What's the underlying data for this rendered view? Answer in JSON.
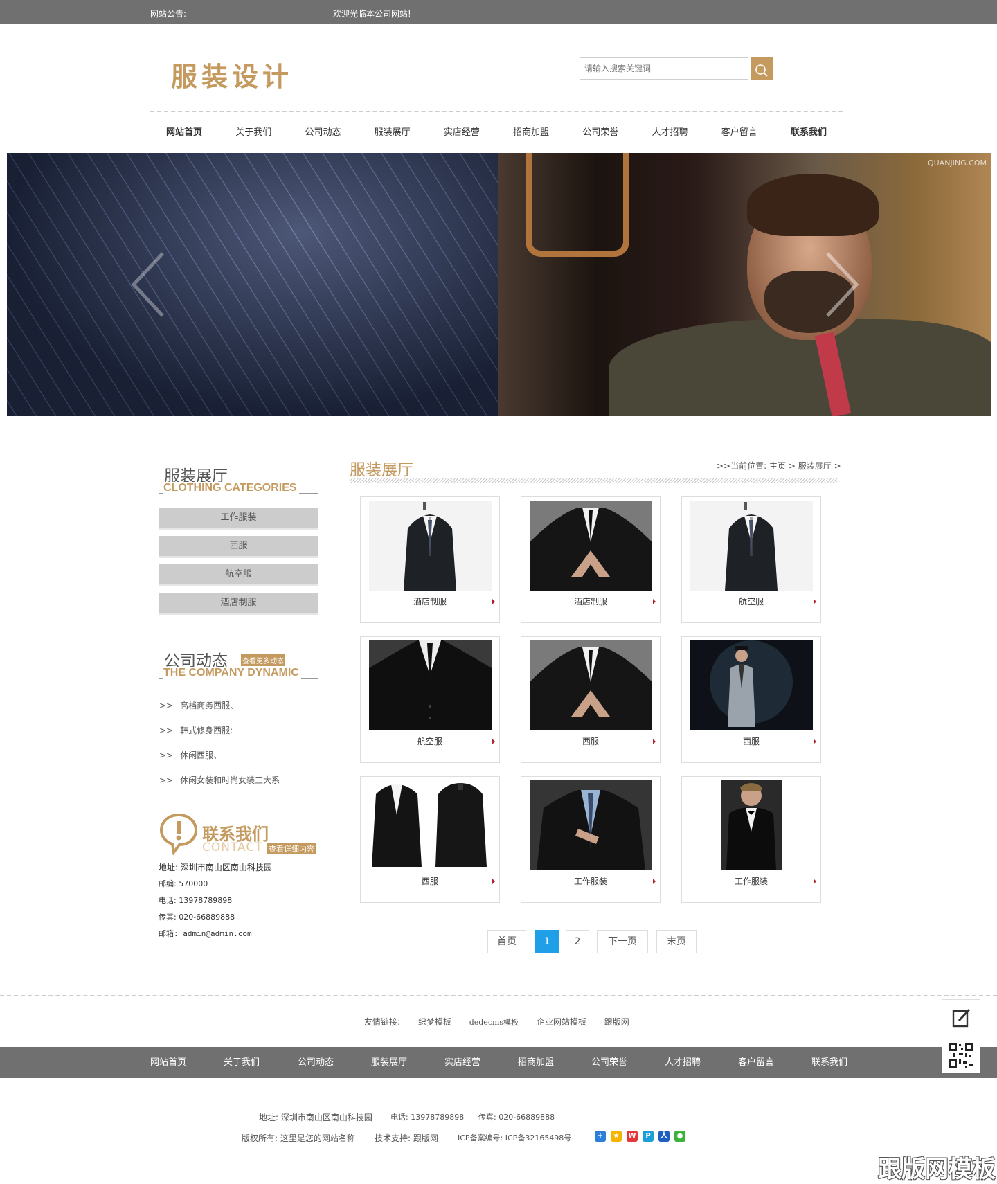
{
  "topbar": {
    "notice_label": "网站公告:",
    "notice_text": "欢迎光临本公司网站!"
  },
  "header": {
    "logo_text": "服装设计",
    "search_placeholder": "请输入搜索关键词"
  },
  "nav": [
    {
      "label": "网站首页",
      "active": true
    },
    {
      "label": "关于我们"
    },
    {
      "label": "公司动态"
    },
    {
      "label": "服装展厅"
    },
    {
      "label": "实店经营"
    },
    {
      "label": "招商加盟"
    },
    {
      "label": "公司荣誉"
    },
    {
      "label": "人才招聘"
    },
    {
      "label": "客户留言"
    },
    {
      "label": "联系我们",
      "bold": true
    }
  ],
  "banner": {
    "watermark": "QUANJING.COM"
  },
  "sidebar": {
    "categories_title_cn": "服装展厅",
    "categories_title_en": "CLOTHING CATEGORIES",
    "categories": [
      "工作服装",
      "西服",
      "航空服",
      "酒店制服"
    ],
    "news_title_cn": "公司动态",
    "news_title_en": "THE COMPANY DYNAMIC",
    "news_more": "查看更多动态",
    "news": [
      "高档商务西服、",
      "韩式修身西服:",
      "休闲西服、",
      "休闲女装和时尚女装三大系"
    ],
    "contact_title_cn": "联系我们",
    "contact_title_en": "CONTACT",
    "contact_more": "查看详细内容",
    "contact_lines": [
      "地址: 深圳市南山区南山科技园",
      "邮编: 570000",
      "电话: 13978789898",
      "传真: 020-66889888",
      "邮箱: admin@admin.com"
    ]
  },
  "main": {
    "title": "服装展厅",
    "breadcrumb": {
      "prefix": ">>当前位置:",
      "home": "主页",
      "current": "服装展厅",
      "sep": ">"
    },
    "products": [
      {
        "label": "酒店制服",
        "image": "suit-standing"
      },
      {
        "label": "酒店制服",
        "image": "suit-hands"
      },
      {
        "label": "航空服",
        "image": "suit-standing"
      },
      {
        "label": "航空服",
        "image": "suit-closeup"
      },
      {
        "label": "西服",
        "image": "suit-hands"
      },
      {
        "label": "西服",
        "image": "suit-grey-man"
      },
      {
        "label": "西服",
        "image": "jackets-pair"
      },
      {
        "label": "工作服装",
        "image": "suit-tie"
      },
      {
        "label": "工作服装",
        "image": "tuxedo-man"
      }
    ],
    "pagination": [
      "首页",
      "1",
      "2",
      "下一页",
      "末页"
    ],
    "current_page": "1"
  },
  "footer": {
    "friend_links_label": "友情链接:",
    "friend_links": [
      "织梦模板",
      "dedecms模板",
      "企业网站模板",
      "跟版网"
    ],
    "nav": [
      "网站首页",
      "关于我们",
      "公司动态",
      "服装展厅",
      "实店经营",
      "招商加盟",
      "公司荣誉",
      "人才招聘",
      "客户留言",
      "联系我们"
    ],
    "address": "地址: 深圳市南山区南山科技园",
    "phone": "电话: 13978789898",
    "fax": "传真: 020-66889888",
    "copyright": "版权所有: 这里是您的网站名称",
    "support": "技术支持: 跟版网",
    "icp": "ICP备案编号: ICP备32165498号",
    "share_icons": [
      "share-more-icon",
      "qzone-icon",
      "weibo-icon",
      "tencent-weibo-icon",
      "renren-icon",
      "wechat-icon"
    ]
  },
  "corner_mark": "跟版网模板",
  "colors": {
    "accent": "#c49a5f",
    "bar": "#707070",
    "pager_active": "#1e9fe8"
  }
}
